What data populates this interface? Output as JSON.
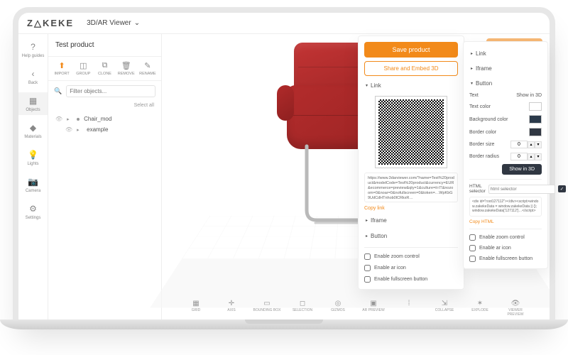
{
  "logo": "Z△KEKE",
  "viewer_dropdown": "3D/AR Viewer",
  "rail": [
    {
      "icon": "?",
      "label": "Help guides"
    },
    {
      "icon": "‹",
      "label": "Back"
    },
    {
      "icon": "▦",
      "label": "Objects"
    },
    {
      "icon": "◆",
      "label": "Materials"
    },
    {
      "icon": "💡",
      "label": "Lights"
    },
    {
      "icon": "📷",
      "label": "Camera"
    },
    {
      "icon": "⚙",
      "label": "Settings"
    }
  ],
  "product_title": "Test product",
  "toolbar": [
    {
      "icon": "⬆",
      "label": "IMPORT",
      "accent": true
    },
    {
      "icon": "◫",
      "label": "GROUP"
    },
    {
      "icon": "⧉",
      "label": "CLONE"
    },
    {
      "icon": "🗑",
      "label": "REMOVE"
    },
    {
      "icon": "✎",
      "label": "RENAME"
    }
  ],
  "filter_placeholder": "Filter objects...",
  "select_all": "Select all",
  "tree": [
    {
      "label": "Chair_mod",
      "expandable": true
    },
    {
      "label": "example",
      "expandable": true,
      "child": true
    }
  ],
  "bottombar": [
    {
      "icon": "▦",
      "label": "GRID"
    },
    {
      "icon": "✛",
      "label": "AXIS"
    },
    {
      "icon": "▭",
      "label": "BOUNDING BOX"
    },
    {
      "icon": "◻",
      "label": "SELECTION"
    },
    {
      "icon": "◎",
      "label": "GIZMOS"
    },
    {
      "icon": "▣",
      "label": "AR PREVIEW"
    },
    {
      "icon": "⁞",
      "label": ""
    },
    {
      "icon": "⇲",
      "label": "COLLAPSE"
    },
    {
      "icon": "✶",
      "label": "EXPLODE"
    },
    {
      "icon": "👁",
      "label": "VIEWER PREVIEW"
    }
  ],
  "canvas_save_btn": "Save product",
  "panel1": {
    "save": "Save product",
    "share": "Share and Embed 3D",
    "acc_link": "Link",
    "acc_iframe": "Iframe",
    "acc_button": "Button",
    "url": "https://www.3darviewer.com/?name=Test%20product&modelCode=Test%20product&currency=EUR&ecommerce=preview&qty=1&culture=it-IT&nozoom=0&noar=0&nofullscreen=0&token=…WpKbG9UdCdHTnhob0lCRkxR…",
    "copy": "Copy link",
    "chk1": "Enable zoom control",
    "chk2": "Enable ar icon",
    "chk3": "Enable fullscreen button"
  },
  "panel2": {
    "acc_link": "Link",
    "acc_iframe": "Iframe",
    "acc_button": "Button",
    "text_lbl": "Text",
    "text_val": "Show in 3D",
    "textcolor_lbl": "Text color",
    "bgcolor_lbl": "Background color",
    "bordercolor_lbl": "Border color",
    "bordersize_lbl": "Border size",
    "bordersize_val": "0",
    "borderradius_lbl": "Border radius",
    "borderradius_val": "0",
    "preview_btn": "Show in 3D",
    "selector_lbl": "HTML selector",
    "selector_ph": "html selector",
    "validate": "✓",
    "snippet": "<div id=\"root127112\"></div><script>window.zakekeData = window.zakekeData || {};window.zakekeData['127112']…</script>",
    "copy": "Copy HTML",
    "chk1": "Enable zoom control",
    "chk2": "Enable ar icon",
    "chk3": "Enable fullscreen button"
  }
}
